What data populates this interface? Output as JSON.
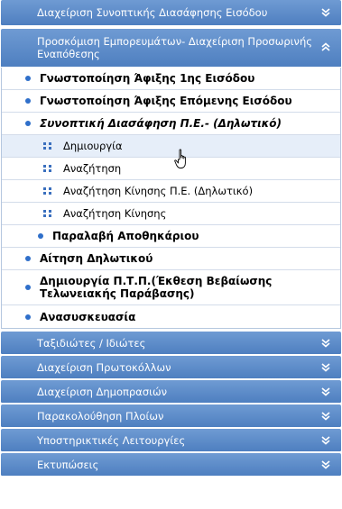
{
  "menu": {
    "top_header": "Διαχείριση Συνοπτικής Διασάφησης Εισόδου",
    "open_section": {
      "header": "Προσκόμιση Εμπορευμάτων- Διαχείριση Προσωρινής Εναπόθεσης",
      "items": [
        {
          "label": "Γνωστοποίηση Άφιξης 1ης Εισόδου"
        },
        {
          "label": "Γνωστοποίηση Άφιξης Επόμενης Εισόδου"
        },
        {
          "label": "Συνοπτική Διασάφηση Π.Ε.- (Δηλωτικό)"
        }
      ],
      "subitems": [
        {
          "label": "Δημιουργία"
        },
        {
          "label": "Αναζήτηση"
        },
        {
          "label": "Αναζήτηση Κίνησης Π.Ε. (Δηλωτικό)"
        },
        {
          "label": "Αναζήτηση Κίνησης"
        }
      ],
      "items_after": [
        {
          "label": "Παραλαβή Αποθηκάριου"
        }
      ]
    },
    "root_items": [
      {
        "label": "Αίτηση Δηλωτικού"
      },
      {
        "label": "Δημιουργία Π.Τ.Π.(Έκθεση Βεβαίωσης Τελωνειακής Παράβασης)"
      },
      {
        "label": "Ανασυσκευασία"
      }
    ],
    "sections": [
      {
        "label": "Ταξιδιώτες / Ιδιώτες"
      },
      {
        "label": "Διαχείριση Πρωτοκόλλων"
      },
      {
        "label": "Διαχείριση Δημοπρασιών"
      },
      {
        "label": "Παρακολούθηση Πλοίων"
      },
      {
        "label": "Υποστηρικτικές Λειτουργίες"
      },
      {
        "label": "Εκτυπώσεις"
      }
    ],
    "icons": {
      "expand": "chevron-double-down-icon",
      "collapse": "chevron-double-up-icon",
      "cursor": "hand-pointer-icon"
    },
    "colors": {
      "header_bg": "#5c8bc8",
      "bullet": "#2f6fca",
      "hover_row": "#e6eef9"
    }
  }
}
